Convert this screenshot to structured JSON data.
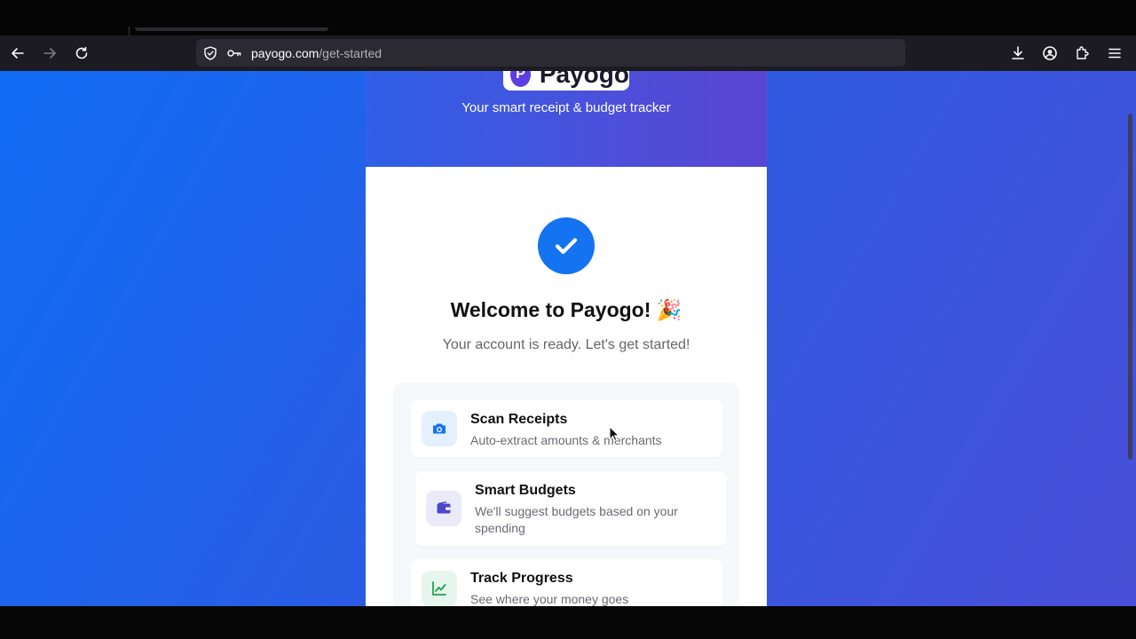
{
  "browser": {
    "url_host": "payogo.com",
    "url_path": "/get-started",
    "icons": [
      "back-icon",
      "forward-icon",
      "reload-icon",
      "shield-icon",
      "key-icon",
      "star-icon",
      "download-icon",
      "account-icon",
      "extensions-icon",
      "menu-icon"
    ]
  },
  "header": {
    "logo_letter": "P",
    "logo_text": "Payogo",
    "tagline": "Your smart receipt & budget tracker"
  },
  "welcome": {
    "title": "Welcome to Payogo! 🎉",
    "subtitle": "Your account is ready. Let's get started!"
  },
  "features": [
    {
      "title": "Scan Receipts",
      "description": "Auto-extract amounts & merchants",
      "icon": "camera-icon"
    },
    {
      "title": "Smart Budgets",
      "description": "We'll suggest budgets based on your spending",
      "icon": "wallet-icon"
    },
    {
      "title": "Track Progress",
      "description": "See where your money goes",
      "icon": "chart-icon"
    }
  ],
  "colors": {
    "accent": "#1373f0",
    "background_start": "#0f6bf5",
    "background_end": "#4a4fd8",
    "logo": "#5b3fe0"
  }
}
